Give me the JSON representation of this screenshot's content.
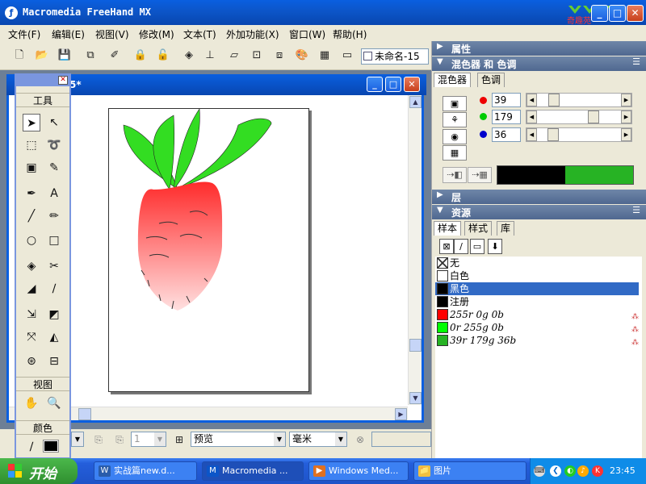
{
  "window": {
    "title": "Macromedia FreeHand MX",
    "logo_text": "奇趣苑",
    "min": "_",
    "max": "□",
    "close": "✕"
  },
  "menu": [
    "文件(F)",
    "编辑(E)",
    "视图(V)",
    "修改(M)",
    "文本(T)",
    "外加功能(X)",
    "窗口(W)",
    "帮助(H)"
  ],
  "toolbar": {
    "document_select": "未命名-15"
  },
  "document": {
    "title": "5*"
  },
  "tools_panel": {
    "tools_label": "工具",
    "view_label": "视图",
    "color_label": "颜色",
    "tools": [
      {
        "name": "pointer-tool",
        "glyph": "➤"
      },
      {
        "name": "subselect-tool",
        "glyph": "↖"
      },
      {
        "name": "page-tool",
        "glyph": "⬚"
      },
      {
        "name": "lasso-tool",
        "glyph": "➰"
      },
      {
        "name": "trace-tool",
        "glyph": "▣"
      },
      {
        "name": "eyedropper-tool",
        "glyph": "✎"
      },
      {
        "name": "pen-tool",
        "glyph": "✒"
      },
      {
        "name": "text-tool",
        "glyph": "A"
      },
      {
        "name": "line-tool",
        "glyph": "╱"
      },
      {
        "name": "pencil-tool",
        "glyph": "✏"
      },
      {
        "name": "ellipse-tool",
        "glyph": "○"
      },
      {
        "name": "rectangle-tool",
        "glyph": "□"
      },
      {
        "name": "perspective-tool",
        "glyph": "◈"
      },
      {
        "name": "knife-tool",
        "glyph": "✂"
      },
      {
        "name": "eraser-tool",
        "glyph": "◢"
      },
      {
        "name": "brush-tool",
        "glyph": "∕"
      },
      {
        "name": "scale-tool",
        "glyph": "⇲"
      },
      {
        "name": "fill-tool",
        "glyph": "◩"
      },
      {
        "name": "freeform-tool",
        "glyph": "⤧"
      },
      {
        "name": "mirror-tool",
        "glyph": "◭"
      },
      {
        "name": "link-tool",
        "glyph": "⊛"
      },
      {
        "name": "connector-tool",
        "glyph": "⊟"
      },
      {
        "name": "hand-tool",
        "glyph": "✋"
      },
      {
        "name": "zoom-tool",
        "glyph": "🔍"
      },
      {
        "name": "stroke-color-tool",
        "glyph": "∕"
      }
    ]
  },
  "status": {
    "page_num": "1",
    "view_mode": "预览",
    "units": "毫米"
  },
  "panels": {
    "properties": "属性",
    "mixer_header": "混色器 和 色调",
    "mixer_tab": "混色器",
    "tint_tab": "色调",
    "layers": "层",
    "assets": "资源",
    "swatches_tab": "样本",
    "styles_tab": "样式",
    "library_tab": "库",
    "menu_glyph": "☰"
  },
  "mixer": {
    "r": "39",
    "g": "179",
    "b": "36",
    "r_frac": 0.15,
    "g_frac": 0.7,
    "b_frac": 0.14,
    "old_color": "#000000",
    "new_color": "#27b324"
  },
  "swatches": [
    {
      "label": "无",
      "color": "none",
      "italic": false
    },
    {
      "label": "白色",
      "color": "#ffffff",
      "italic": false
    },
    {
      "label": "黑色",
      "color": "#000000",
      "italic": false,
      "selected": true
    },
    {
      "label": "注册",
      "color": "#000000",
      "italic": false
    },
    {
      "label": "255r 0g 0b",
      "color": "#ff0000",
      "italic": true,
      "process": true
    },
    {
      "label": "0r 255g 0b",
      "color": "#00ff00",
      "italic": true,
      "process": true
    },
    {
      "label": "39r 179g 36b",
      "color": "#27b324",
      "italic": true,
      "process": true
    }
  ],
  "taskbar": {
    "start": "开始",
    "tasks": [
      {
        "label": "实战篇new.d...",
        "icon": "W"
      },
      {
        "label": "Macromedia ...",
        "icon": "M",
        "active": true
      },
      {
        "label": "Windows Med...",
        "icon": "▶"
      },
      {
        "label": "图片",
        "icon": "📁"
      }
    ],
    "clock": "23:45"
  },
  "colors": {
    "accent": "#0a5fe0",
    "selection": "#316ac5",
    "radish_top": "#ff2b2b",
    "leaf": "#33dd22"
  }
}
